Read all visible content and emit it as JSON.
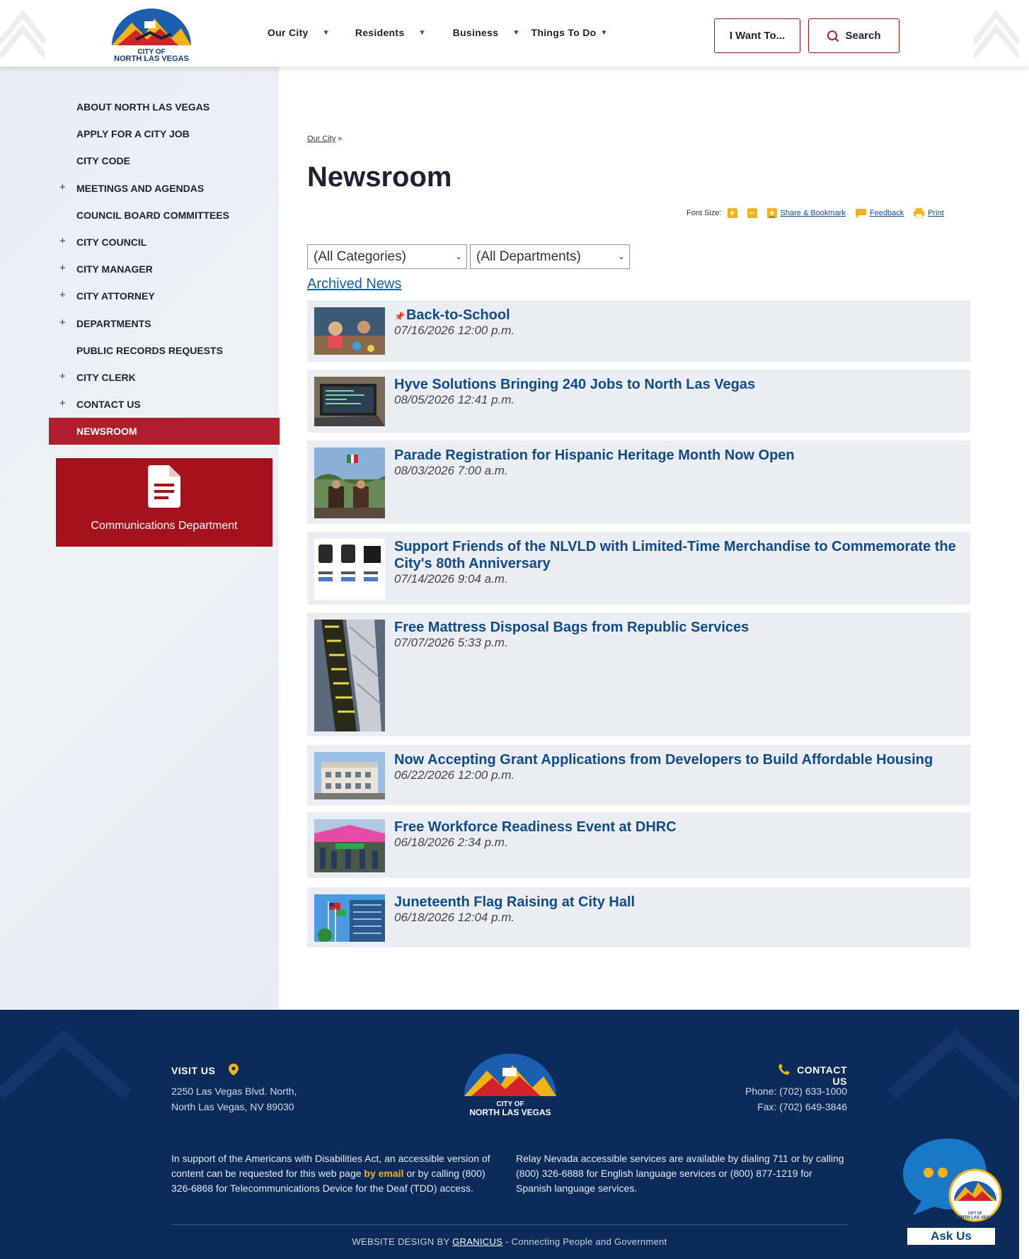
{
  "header": {
    "logo_line1": "CITY OF",
    "logo_line2": "NORTH LAS VEGAS",
    "nav": [
      {
        "label": "Our City"
      },
      {
        "label": "Residents"
      },
      {
        "label": "Business"
      },
      {
        "label": "Things To Do"
      }
    ],
    "want_label": "I Want To...",
    "search_label": "Search"
  },
  "sidebar": {
    "items": [
      {
        "label": "ABOUT NORTH LAS VEGAS",
        "expandable": false
      },
      {
        "label": "APPLY FOR A CITY JOB",
        "expandable": false
      },
      {
        "label": "CITY CODE",
        "expandable": false
      },
      {
        "label": "MEETINGS AND AGENDAS",
        "expandable": true
      },
      {
        "label": "COUNCIL BOARD COMMITTEES",
        "expandable": false
      },
      {
        "label": "CITY COUNCIL",
        "expandable": true
      },
      {
        "label": "CITY MANAGER",
        "expandable": true
      },
      {
        "label": "CITY ATTORNEY",
        "expandable": true
      },
      {
        "label": "DEPARTMENTS",
        "expandable": true
      },
      {
        "label": "PUBLIC RECORDS REQUESTS",
        "expandable": false
      },
      {
        "label": "CITY CLERK",
        "expandable": true
      },
      {
        "label": "CONTACT US",
        "expandable": true
      },
      {
        "label": "NEWSROOM",
        "expandable": false,
        "active": true
      }
    ],
    "plus": "+",
    "comm_label": "Communications Department"
  },
  "main": {
    "breadcrumb_link": "Our City",
    "breadcrumb_sep": "»",
    "title": "Newsroom",
    "tools": {
      "font_size_label": "Font Size:",
      "share_label": "Share & Bookmark",
      "feedback_label": "Feedback",
      "print_label": "Print"
    },
    "category_select": "(All Categories)",
    "department_select": "(All Departments)",
    "archived_label": "Archived News",
    "news": [
      {
        "title": "Back-to-School",
        "date": "07/16/2026 12:00 p.m.",
        "pinned": true
      },
      {
        "title": "Hyve Solutions Bringing 240 Jobs to North Las Vegas",
        "date": "08/05/2026 12:41 p.m."
      },
      {
        "title": "Parade Registration for Hispanic Heritage Month Now Open",
        "date": "08/03/2026 7:00 a.m."
      },
      {
        "title": "Support Friends of the NLVLD with Limited-Time Merchandise to Commemorate the City's 80th Anniversary",
        "date": "07/14/2026 9:04 a.m."
      },
      {
        "title": "Free Mattress Disposal Bags from Republic Services",
        "date": "07/07/2026 5:33 p.m."
      },
      {
        "title": "Now Accepting Grant Applications from Developers to Build Affordable Housing",
        "date": "06/22/2026 12:00 p.m."
      },
      {
        "title": "Free Workforce Readiness Event at DHRC",
        "date": "06/18/2026 2:34 p.m."
      },
      {
        "title": "Juneteenth Flag Raising at City Hall",
        "date": "06/18/2026 12:04 p.m."
      }
    ]
  },
  "footer": {
    "visit_label": "VISIT US",
    "address1": "2250 Las Vegas Blvd. North,",
    "address2": "North Las Vegas, NV 89030",
    "contact_label": "CONTACT US",
    "phone": "Phone: (702) 633-1000",
    "fax": "Fax: (702) 649-3846",
    "logo_line1": "CITY OF",
    "logo_line2": "NORTH LAS VEGAS",
    "ada_pre": "In support of the Americans with Disabilities Act, an accessible version of content can be requested for this web page",
    "ada_link": "by email",
    "ada_post": "or by calling (800) 326-6868 for Telecommunications Device for the Deaf (TDD) access.",
    "relay": "Relay Nevada accessible services are available by dialing 711 or by calling (800) 326-6888 for English language services or (800) 877-1219 for Spanish language services.",
    "credit_pre": "WEBSITE DESIGN BY",
    "credit_link": "GRANICUS",
    "credit_post": "- Connecting People and Government",
    "ask_label": "Ask Us",
    "ask_logo_line1": "CITY OF",
    "ask_logo_line2": "NORTH LAS VEGAS"
  },
  "colors": {
    "accent_red": "#b11e2b",
    "link_blue": "#0e4a8c",
    "footer_navy": "#0c2b5b",
    "gold": "#f2b318"
  }
}
